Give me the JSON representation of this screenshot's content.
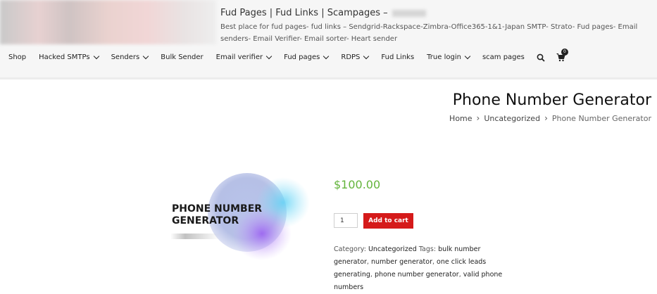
{
  "header": {
    "site_title": "Fud Pages | Fud Links | Scampages –",
    "tagline": "Best place for fud pages- fud links – Sendgrid-Rackspace-Zimbra-Office365-1&1-Japan SMTP- Strato- Fud pages- Email senders- Email Verifier- Email sorter- Heart sender"
  },
  "nav": {
    "items": [
      {
        "label": "Shop",
        "dropdown": false
      },
      {
        "label": "Hacked SMTPs",
        "dropdown": true
      },
      {
        "label": "Senders",
        "dropdown": true
      },
      {
        "label": "Bulk Sender",
        "dropdown": false
      },
      {
        "label": "Email verifier",
        "dropdown": true
      },
      {
        "label": "Fud pages",
        "dropdown": true
      },
      {
        "label": "RDPS",
        "dropdown": true
      },
      {
        "label": "Fud Links",
        "dropdown": false
      },
      {
        "label": "True login",
        "dropdown": true
      },
      {
        "label": "scam pages",
        "dropdown": false
      }
    ],
    "search_icon": "search-icon",
    "cart_icon": "cart-icon",
    "cart_count": "0"
  },
  "page": {
    "title": "Phone Number Generator",
    "breadcrumb": [
      "Home",
      "Uncategorized",
      "Phone Number Generator"
    ],
    "breadcrumb_sep": "›"
  },
  "product": {
    "image_text_line1": "PHONE NUMBER",
    "image_text_line2": "GENERATOR",
    "price": "$100.00",
    "price_color": "#63b43b",
    "quantity": "1",
    "add_to_cart": "Add to cart",
    "button_color": "#d51a1a",
    "category_label": "Category:",
    "category": "Uncategorized",
    "tags_label": "Tags:",
    "tags": [
      "bulk number generator",
      "number generator",
      "one click leads generating",
      "phone number generator",
      "valid phone numbers"
    ]
  }
}
